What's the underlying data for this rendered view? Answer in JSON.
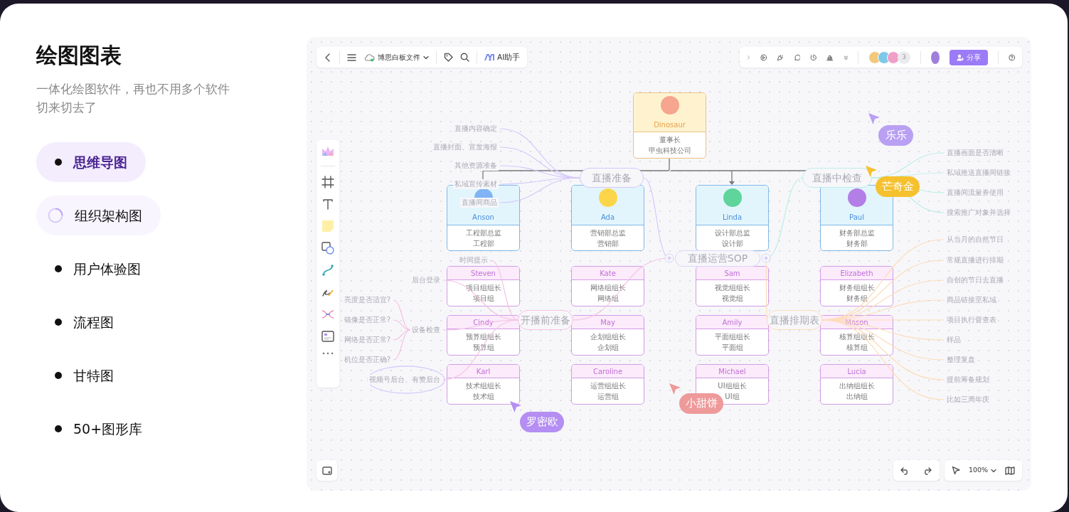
{
  "heading": {
    "title": "绘图图表",
    "subtitle": "一体化绘图软件，再也不用多个软件切来切去了"
  },
  "features": [
    {
      "label": "思维导图",
      "selected": true,
      "loading": false
    },
    {
      "label": "组织架构图",
      "selected": false,
      "loading": true
    },
    {
      "label": "用户体验图",
      "selected": false,
      "loading": false
    },
    {
      "label": "流程图",
      "selected": false,
      "loading": false
    },
    {
      "label": "甘特图",
      "selected": false,
      "loading": false
    },
    {
      "label": "50+图形库",
      "selected": false,
      "loading": false
    }
  ],
  "board": {
    "file_name": "博思白板文件",
    "ai_label": "AI助手",
    "collaborator_count": "3",
    "share_label": "分享",
    "zoom": "100%",
    "org_chart": {
      "root": {
        "name": "Dinosaur",
        "title": "董事长",
        "department": "甲虫科技公司",
        "color": "#f6a58e"
      },
      "departments": [
        {
          "name": "Anson",
          "title": "工程部总监",
          "department": "工程部",
          "color": "#80b4f4",
          "teams": [
            {
              "name": "Steven",
              "title": "项目组组长",
              "department": "项目组"
            },
            {
              "name": "Cindy",
              "title": "预算组组长",
              "department": "预算组"
            },
            {
              "name": "Karl",
              "title": "技术组组长",
              "department": "技术组"
            }
          ]
        },
        {
          "name": "Ada",
          "title": "营销部总监",
          "department": "营销部",
          "color": "#fcd64a",
          "teams": [
            {
              "name": "Kate",
              "title": "网络组组长",
              "department": "网络组"
            },
            {
              "name": "May",
              "title": "企划组组长",
              "department": "企划组"
            },
            {
              "name": "Caroline",
              "title": "运营组组长",
              "department": "运营组"
            }
          ]
        },
        {
          "name": "Linda",
          "title": "设计部总监",
          "department": "设计部",
          "color": "#5fd49b",
          "teams": [
            {
              "name": "Sam",
              "title": "视觉组组长",
              "department": "视觉组"
            },
            {
              "name": "Amily",
              "title": "平面组组长",
              "department": "平面组"
            },
            {
              "name": "Michael",
              "title": "UI组组长",
              "department": "UI组"
            }
          ]
        },
        {
          "name": "Paul",
          "title": "财务部总监",
          "department": "财务部",
          "color": "#b37ee6",
          "teams": [
            {
              "name": "Elizabeth",
              "title": "财务组组长",
              "department": "财务组"
            },
            {
              "name": "Mason",
              "title": "核算组组长",
              "department": "核算组"
            },
            {
              "name": "Lucia",
              "title": "出纳组组长",
              "department": "出纳组"
            }
          ]
        }
      ]
    },
    "mind_map": {
      "center": "直播运营SOP",
      "branches": [
        {
          "label": "直播准备",
          "color": "#d6c8fa",
          "children": [
            {
              "label": "直播内容确定"
            },
            {
              "label": "直播封面、宣发海报"
            },
            {
              "label": "其他资源准备"
            },
            {
              "label": "私域宣传素材"
            },
            {
              "label": "直播间商品"
            }
          ]
        },
        {
          "label": "开播前准备",
          "color": "#f5c2e4",
          "children": [
            {
              "label": "时间提示"
            },
            {
              "label": "后台登录"
            },
            {
              "label": "设备检查",
              "children": [
                {
                  "label": "亮度是否适宜?"
                },
                {
                  "label": "镜像是否正常?"
                },
                {
                  "label": "网络是否正常?"
                },
                {
                  "label": "机位是否正确?"
                }
              ]
            },
            {
              "label": "视频号后台、有赞后台"
            }
          ]
        },
        {
          "label": "直播中检查",
          "color": "#bdeee4",
          "children": [
            {
              "label": "直播画面是否清晰"
            },
            {
              "label": "私域推送直播间链接"
            },
            {
              "label": "直播间流量券使用"
            },
            {
              "label": "搜索推广对象并选择"
            }
          ]
        },
        {
          "label": "直播排期表",
          "color": "#fddcb8",
          "children": [
            {
              "label": "从当月的自然节日"
            },
            {
              "label": "常规直播进行排期"
            },
            {
              "label": "自创的节日去直播"
            },
            {
              "label": "商品链接至私域"
            },
            {
              "label": "项目执行督查表"
            },
            {
              "label": "样品"
            },
            {
              "label": "整理复盘"
            },
            {
              "label": "提前筹备规划"
            },
            {
              "label": "比如三周年庆"
            }
          ]
        }
      ]
    },
    "cursors": [
      {
        "name": "乐乐",
        "color": "#b9a0f3"
      },
      {
        "name": "芒奇金",
        "color": "#f5c12e"
      },
      {
        "name": "罗密欧",
        "color": "#b48ef2"
      },
      {
        "name": "小甜饼",
        "color": "#ee9a9a"
      }
    ]
  }
}
